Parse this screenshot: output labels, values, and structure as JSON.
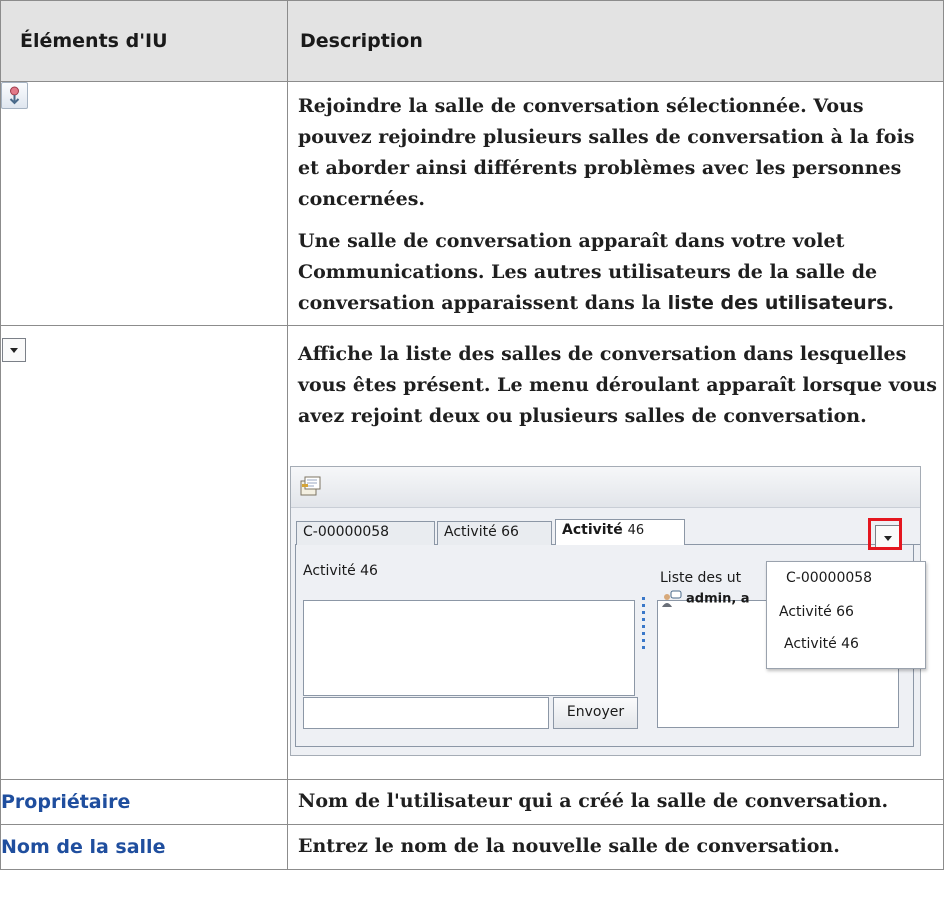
{
  "table": {
    "headers": {
      "col1": "Éléments d'IU",
      "col2": "Description"
    },
    "rows": [
      {
        "icon": "join-chat-room-icon",
        "paragraphs": [
          "Rejoindre la salle de conversation sélectionnée. Vous pouvez rejoindre plusieurs salles de conversation à la fois et aborder ainsi différents problèmes avec les personnes concernées.",
          "Une salle de conversation apparaît dans votre volet Communications. Les autres utilisateurs de la salle de conversation apparaissent dans la"
        ],
        "link_text": "liste des utilisateurs",
        "link_suffix": "."
      },
      {
        "icon": "chevron-down-icon",
        "paragraphs": [
          "Affiche la liste des salles de conversation dans lesquelles vous êtes présent. Le menu déroulant apparaît lorsque vous avez rejoint deux ou plusieurs salles de conversation."
        ],
        "screenshot": {
          "tabs": [
            {
              "label": "C-00000058"
            },
            {
              "label": "Activité 66"
            },
            {
              "label": "Activité",
              "num": "46"
            }
          ],
          "room_title": "Activité 46",
          "user_list_label": "Liste des ut",
          "user_entry": "admin, a",
          "send_label": "Envoyer",
          "dropdown_items": [
            "C-00000058",
            "Activité 66",
            "Activité 46"
          ]
        }
      },
      {
        "label": "Propriétaire",
        "description": "Nom de l'utilisateur qui a créé la salle de conversation."
      },
      {
        "label": "Nom de la salle",
        "description": "Entrez le nom de la nouvelle salle de conversation."
      }
    ]
  },
  "colors": {
    "header_bg": "#e3e3e3",
    "link": "#1f4e9e",
    "highlight": "#e4161f",
    "border": "#8c8c8c"
  }
}
